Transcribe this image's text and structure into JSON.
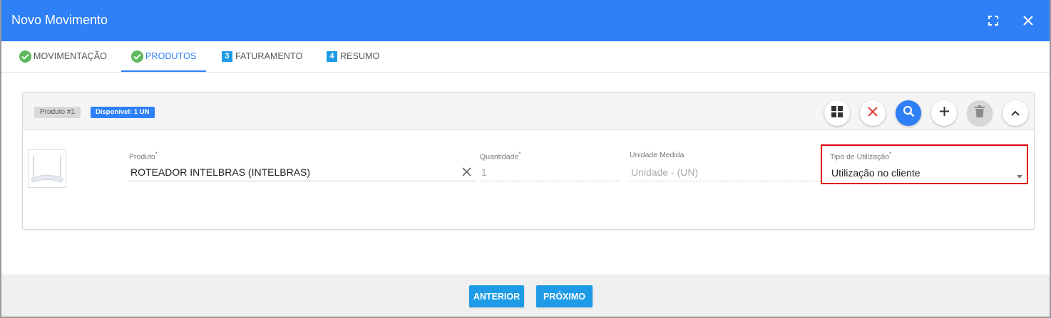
{
  "dialog": {
    "title": "Novo Movimento",
    "expand_icon": "fullscreen-icon",
    "close_icon": "close-icon"
  },
  "tabs": [
    {
      "label": "MOVIMENTAÇÃO",
      "marker": "check-icon",
      "active": false
    },
    {
      "label": "PRODUTOS",
      "marker": "check-icon",
      "active": true
    },
    {
      "label": "FATURAMENTO",
      "marker": "3",
      "active": false
    },
    {
      "label": "RESUMO",
      "marker": "4",
      "active": false
    }
  ],
  "product": {
    "tag": "Produto #1",
    "available": "Disponível: 1 UN",
    "toolbar_icons": [
      "grid-icon",
      "cancel-x-icon",
      "search-icon",
      "plus-icon",
      "trash-icon",
      "chevron-up-icon"
    ],
    "image_icon": "router-icon",
    "fields": {
      "produto": {
        "label": "Produto",
        "required": "*",
        "value": "ROTEADOR INTELBRAS (INTELBRAS)"
      },
      "quantidade": {
        "label": "Quantidade",
        "required": "*",
        "value": "1"
      },
      "unidade": {
        "label": "Unidade Medida",
        "value": "Unidade - (UN)"
      },
      "tipo": {
        "label": "Tipo de Utilização",
        "required": "*",
        "value": "Utilização no cliente"
      }
    }
  },
  "footer": {
    "prev_label": "ANTERIOR",
    "next_label": "PRÓXIMO"
  },
  "colors": {
    "primary": "#2f80f7",
    "button": "#1e9be6",
    "success": "#5cb85c",
    "highlight": "#e0000f"
  }
}
